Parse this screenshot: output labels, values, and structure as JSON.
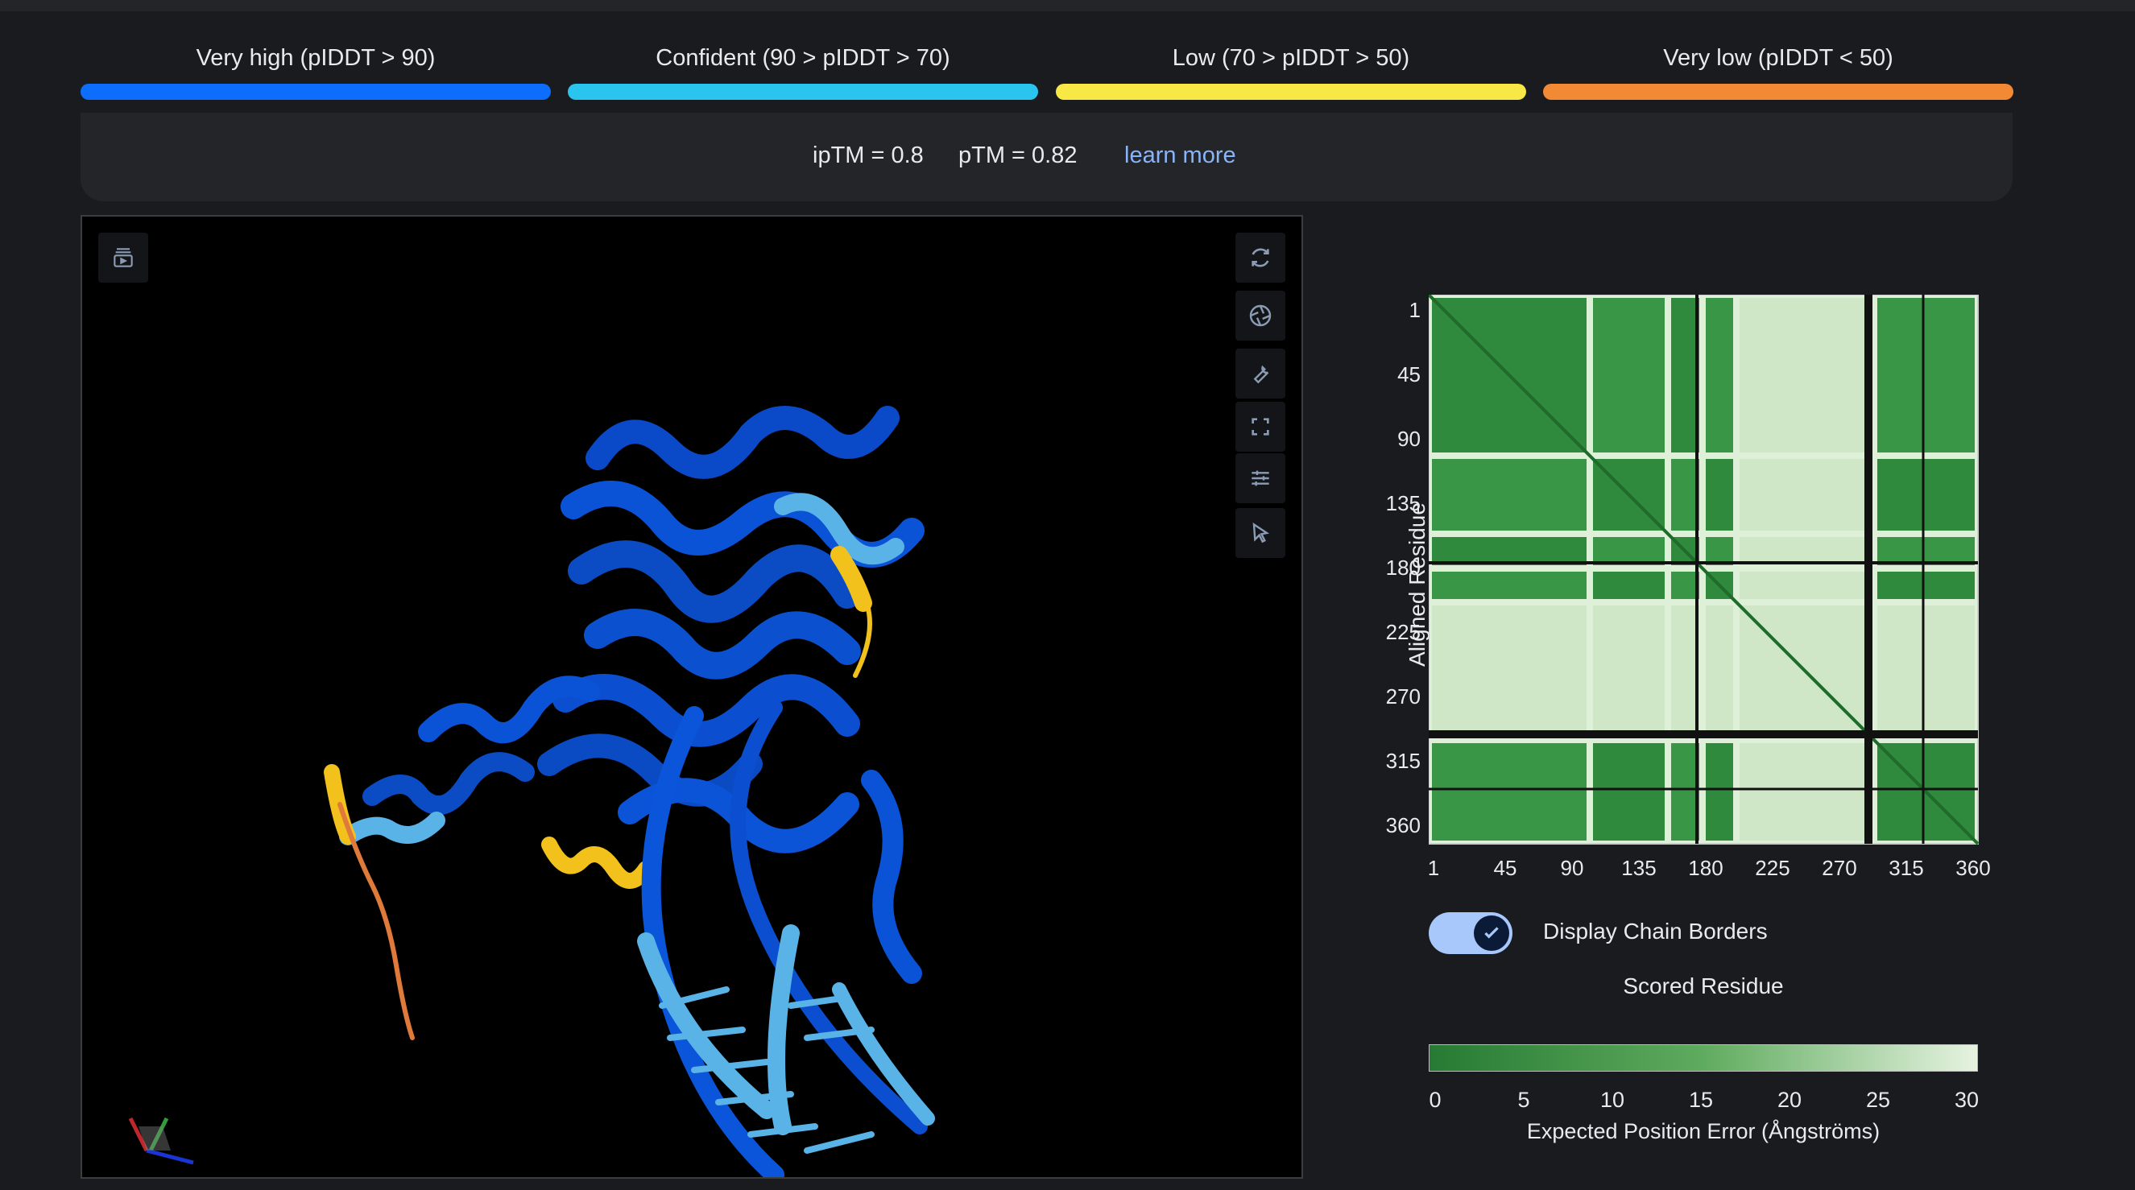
{
  "legend": [
    {
      "label": "Very high (pIDDT > 90)",
      "color": "#0d6efd"
    },
    {
      "label": "Confident (90 > pIDDT > 70)",
      "color": "#29c5ef"
    },
    {
      "label": "Low (70 > pIDDT > 50)",
      "color": "#f7e845"
    },
    {
      "label": "Very low (pIDDT < 50)",
      "color": "#f28a35"
    }
  ],
  "metrics": {
    "iptm": "ipTM = 0.8",
    "ptm": "pTM = 0.82",
    "learn_more": "learn more"
  },
  "viewer": {
    "left_tool_icon": "sequence-panel-icon",
    "tools": [
      "reset-camera-icon",
      "screenshot-icon",
      "wrench-icon",
      "fullscreen-icon",
      "sliders-icon",
      "select-cursor-icon"
    ]
  },
  "pae": {
    "y_label": "Aligned Residue",
    "x_label": "Scored Residue",
    "ticks": [
      "1",
      "45",
      "90",
      "135",
      "180",
      "225",
      "270",
      "315",
      "360"
    ],
    "toggle_label": "Display Chain Borders",
    "toggle_on": true,
    "colorbar_ticks": [
      "0",
      "5",
      "10",
      "15",
      "20",
      "25",
      "30"
    ],
    "colorbar_label": "Expected Position Error (Ångströms)",
    "color_low": "#267a33",
    "color_high": "#e6f3e0"
  }
}
